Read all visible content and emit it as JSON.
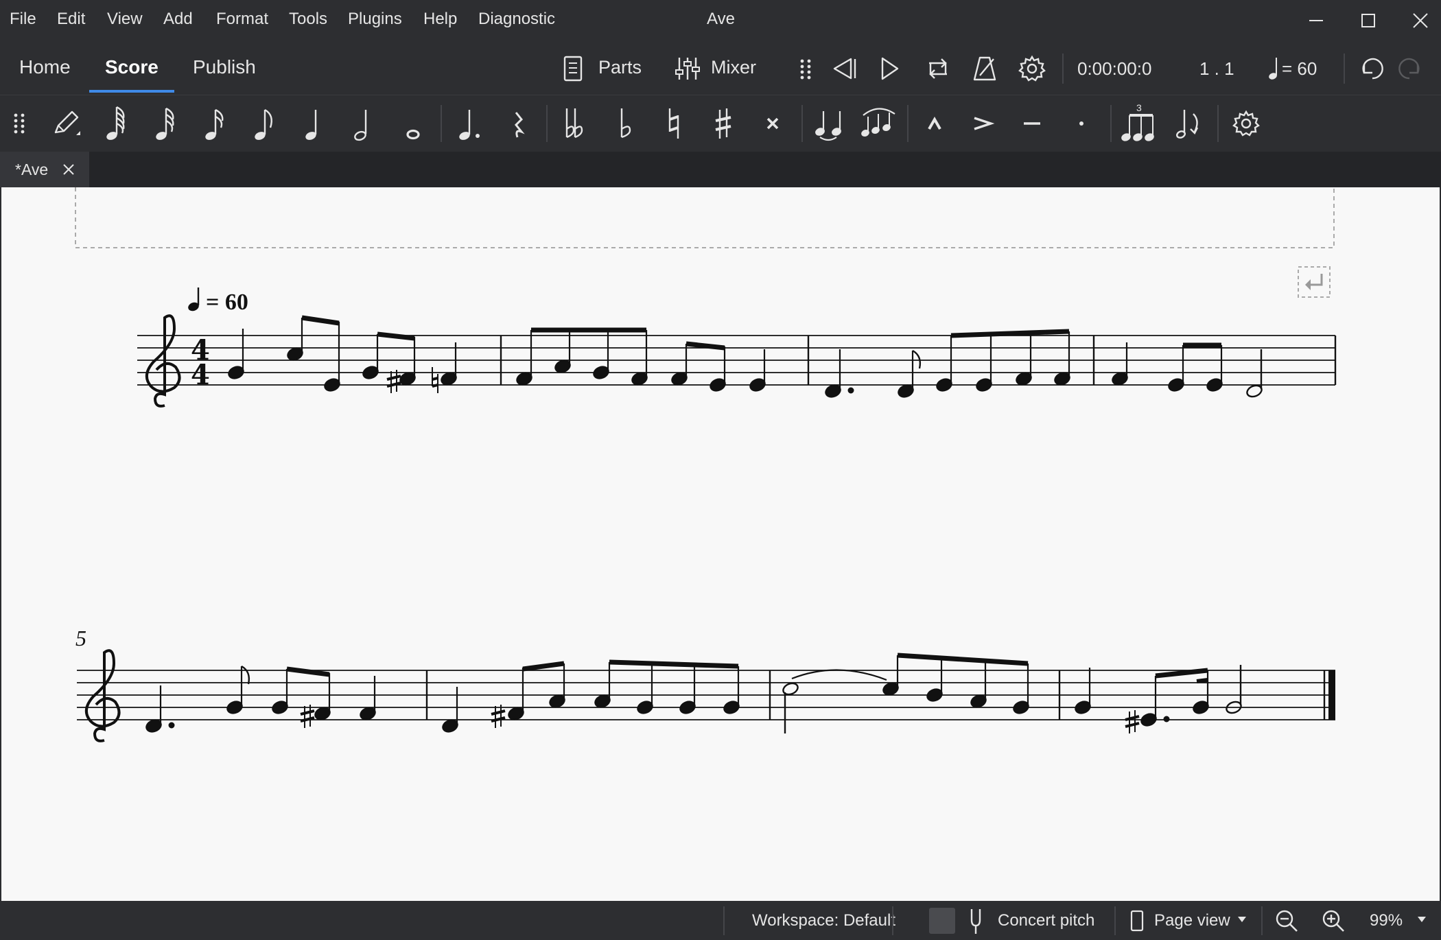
{
  "window": {
    "title": "Ave"
  },
  "menu": [
    "File",
    "Edit",
    "View",
    "Add",
    "Format",
    "Tools",
    "Plugins",
    "Help",
    "Diagnostic"
  ],
  "tabs": {
    "home": "Home",
    "score": "Score",
    "publish": "Publish"
  },
  "toolbar": {
    "parts_label": "Parts",
    "mixer_label": "Mixer",
    "time_display": "0:00:00:0",
    "position_display": "1 . 1",
    "tempo_display": "= 60"
  },
  "document_tab": {
    "label": "*Ave"
  },
  "score": {
    "tempo_marking": "= 60",
    "measure_number_system2": "5"
  },
  "status": {
    "workspace": "Workspace: Default",
    "concert_pitch": "Concert pitch",
    "page_view": "Page view",
    "zoom": "99%"
  },
  "colors": {
    "accent": "#3f8ae8",
    "chrome": "#2d2e31",
    "paper": "#f8f8f8"
  }
}
